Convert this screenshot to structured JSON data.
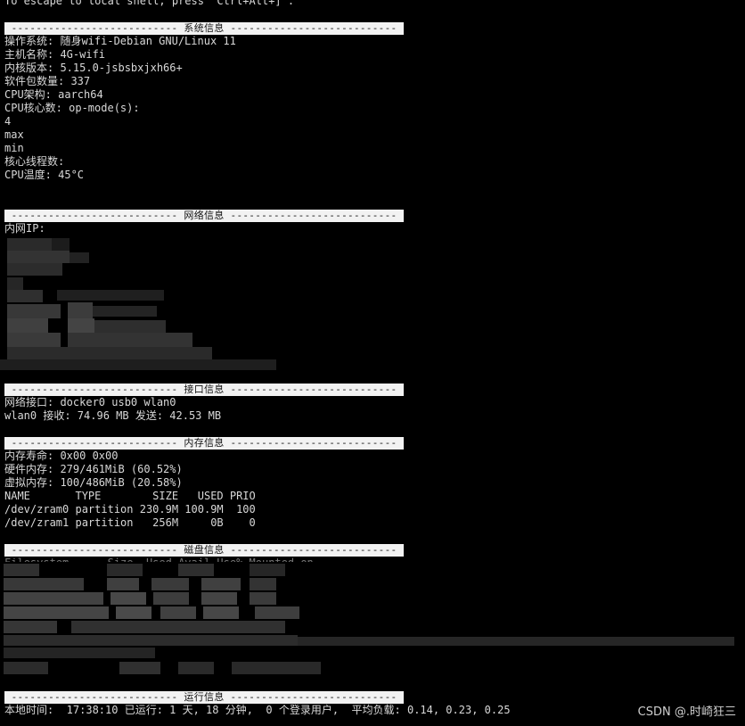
{
  "escape_line": "To escape to local shell, press 'Ctrl+Alt+]'.",
  "sections": {
    "system": {
      "header": "--------------------------- 系统信息 ---------------------------",
      "lines": [
        "操作系统: 随身wifi-Debian GNU/Linux 11",
        "主机名称: 4G-wifi",
        "内核版本: 5.15.0-jsbsbxjxh66+",
        "软件包数量: 337",
        "CPU架构: aarch64",
        "CPU核心数: op-mode(s):",
        "4",
        "max",
        "min",
        "核心线程数:",
        "CPU温度: 45°C"
      ]
    },
    "network": {
      "header": "--------------------------- 网络信息 ---------------------------",
      "lines": [
        "内网IP:"
      ]
    },
    "interface": {
      "header": "--------------------------- 接口信息 ---------------------------",
      "lines": [
        "网络接口: docker0 usb0 wlan0",
        "wlan0 接收: 74.96 MB 发送: 42.53 MB"
      ]
    },
    "memory": {
      "header": "--------------------------- 内存信息 ---------------------------",
      "lines": [
        "内存寿命: 0x00 0x00",
        "硬件内存: 279/461MiB (60.52%)",
        "虚拟内存: 100/486MiB (20.58%)",
        "NAME       TYPE        SIZE   USED PRIO",
        "/dev/zram0 partition 230.9M 100.9M  100",
        "/dev/zram1 partition   256M     0B    0"
      ]
    },
    "disk": {
      "header": "--------------------------- 磁盘信息 ---------------------------",
      "lines": [
        "Filesystem      Size  Used Avail Use% Mounted on"
      ]
    },
    "runtime": {
      "header": "--------------------------- 运行信息 ---------------------------",
      "lines": [
        "本地时间:  17:38:10 已运行: 1 天, 18 分钟,  0 个登录用户,  平均负载: 0.14, 0.23, 0.25"
      ]
    }
  },
  "watermark": "CSDN @.时崎狂三",
  "colors": {
    "background": "#000000",
    "text": "#d8d8d8",
    "header_bg": "#f2f2f2",
    "header_text": "#111111"
  }
}
